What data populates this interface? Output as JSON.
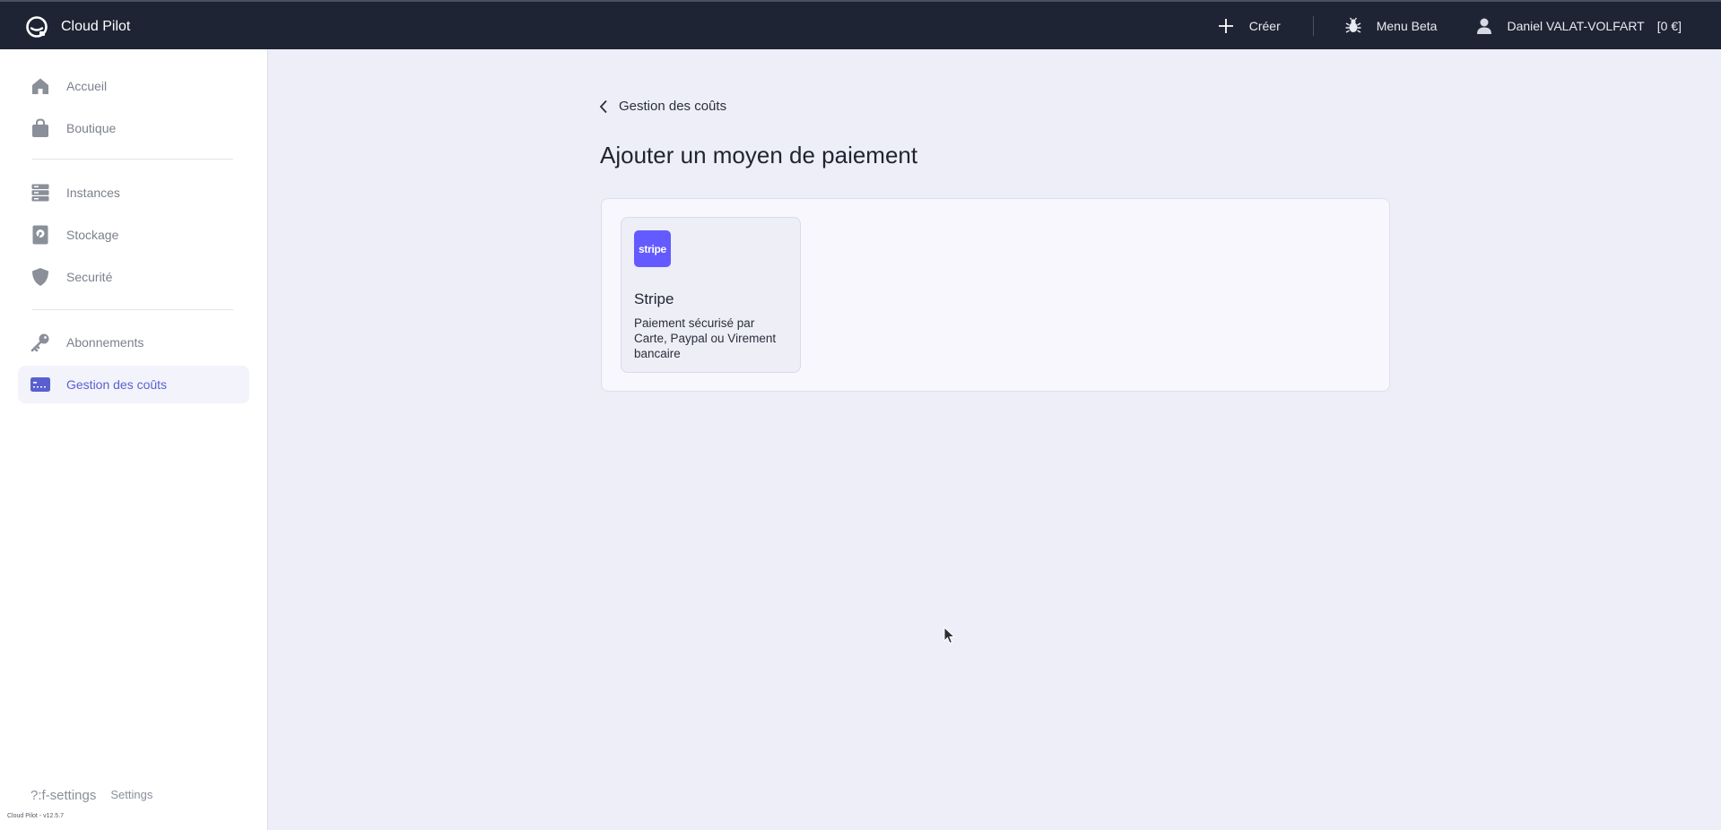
{
  "app": {
    "name": "Cloud Pilot",
    "version": "Cloud Pilot - v12.5.7"
  },
  "topbar": {
    "create_label": "Créer",
    "beta_label": "Menu Beta",
    "user_name": "Daniel VALAT-VOLFART",
    "balance": "[0 €]"
  },
  "sidebar": {
    "items": [
      {
        "label": "Accueil",
        "icon": "home-icon"
      },
      {
        "label": "Boutique",
        "icon": "shopping-bag-icon"
      },
      {
        "label": "Instances",
        "icon": "server-icon"
      },
      {
        "label": "Stockage",
        "icon": "disk-icon"
      },
      {
        "label": "Securité",
        "icon": "shield-icon"
      },
      {
        "label": "Abonnements",
        "icon": "key-icon"
      },
      {
        "label": "Gestion des coûts",
        "icon": "credit-card-icon",
        "active": true
      }
    ],
    "footer": {
      "settings_glyph": "?:f-settings",
      "settings_label": "Settings"
    }
  },
  "main": {
    "back_label": "Gestion des coûts",
    "title": "Ajouter un moyen de paiement",
    "payment_methods": [
      {
        "logo_text": "stripe",
        "name": "Stripe",
        "description": "Paiement sécurisé par Carte, Paypal ou Virement bancaire"
      }
    ]
  },
  "colors": {
    "topbar_bg": "#1e2433",
    "accent": "#5a5fd0",
    "stripe_brand": "#635bff",
    "page_bg": "#eeeef9"
  }
}
